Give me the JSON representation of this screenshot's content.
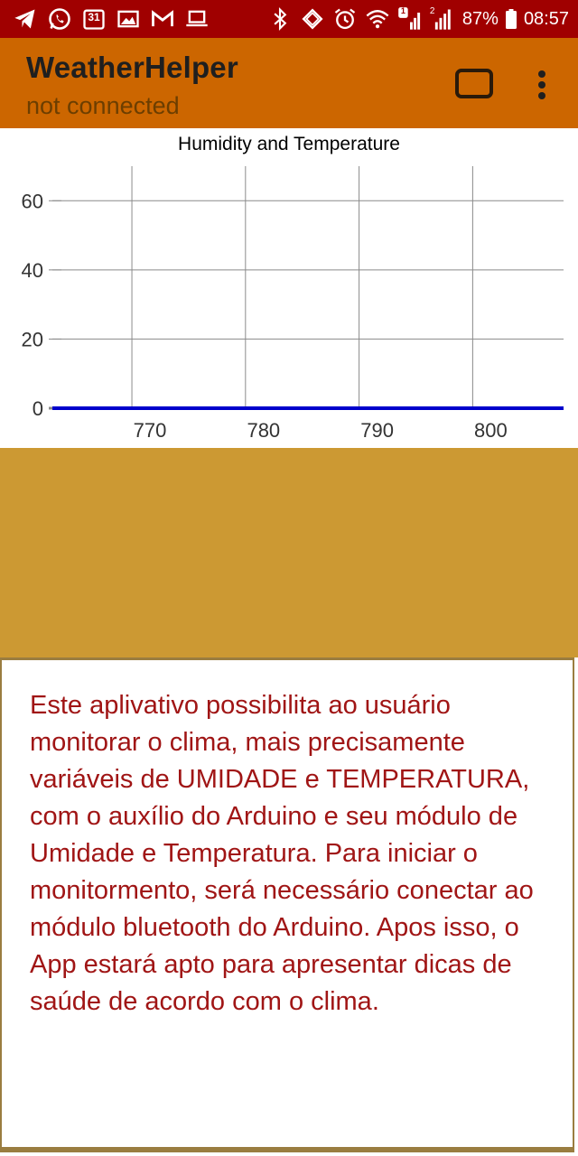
{
  "status_bar": {
    "battery_percent": "87%",
    "time": "08:57",
    "calendar_day": "31",
    "sim_badge_1": "1",
    "sim_badge_2": "2",
    "left_icons": [
      "telegram-icon",
      "whatsapp-icon",
      "calendar-icon",
      "gallery-icon",
      "gmail-icon",
      "laptop-icon"
    ],
    "right_icons": [
      "bluetooth-icon",
      "rotation-icon",
      "alarm-icon",
      "wifi-icon",
      "signal-icon",
      "signal-icon",
      "battery-icon"
    ]
  },
  "app_bar": {
    "title": "WeatherHelper",
    "subtitle": "not connected",
    "bluetooth_button_icon": "connect-icon",
    "menu_icon": "more-vert-icon",
    "color": "#cc6600"
  },
  "chart_data": {
    "type": "line",
    "title": "Humidity and Temperature",
    "xlabel": "",
    "ylabel": "",
    "x_ticks": [
      "770",
      "780",
      "790",
      "800"
    ],
    "y_ticks": [
      "0",
      "20",
      "40",
      "60"
    ],
    "xlim": [
      763,
      808
    ],
    "ylim": [
      0,
      70
    ],
    "grid": true,
    "series": [
      {
        "color": "#0000cc",
        "x": [
          763,
          808
        ],
        "y": [
          0,
          0
        ]
      }
    ]
  },
  "mid_panel": {
    "color": "#cc9933"
  },
  "info": {
    "text": "Este aplivativo possibilita ao usuário monitorar o clima, mais precisamente variáveis de UMIDADE e TEMPERATURA, com o auxílio do Arduino e seu módulo de Umidade e Temperatura. Para iniciar o monitormento, será necessário conectar ao módulo bluetooth do Arduino. Apos isso, o App estará apto para apresentar dicas de saúde de acordo com o clima.",
    "color": "#a01515"
  }
}
